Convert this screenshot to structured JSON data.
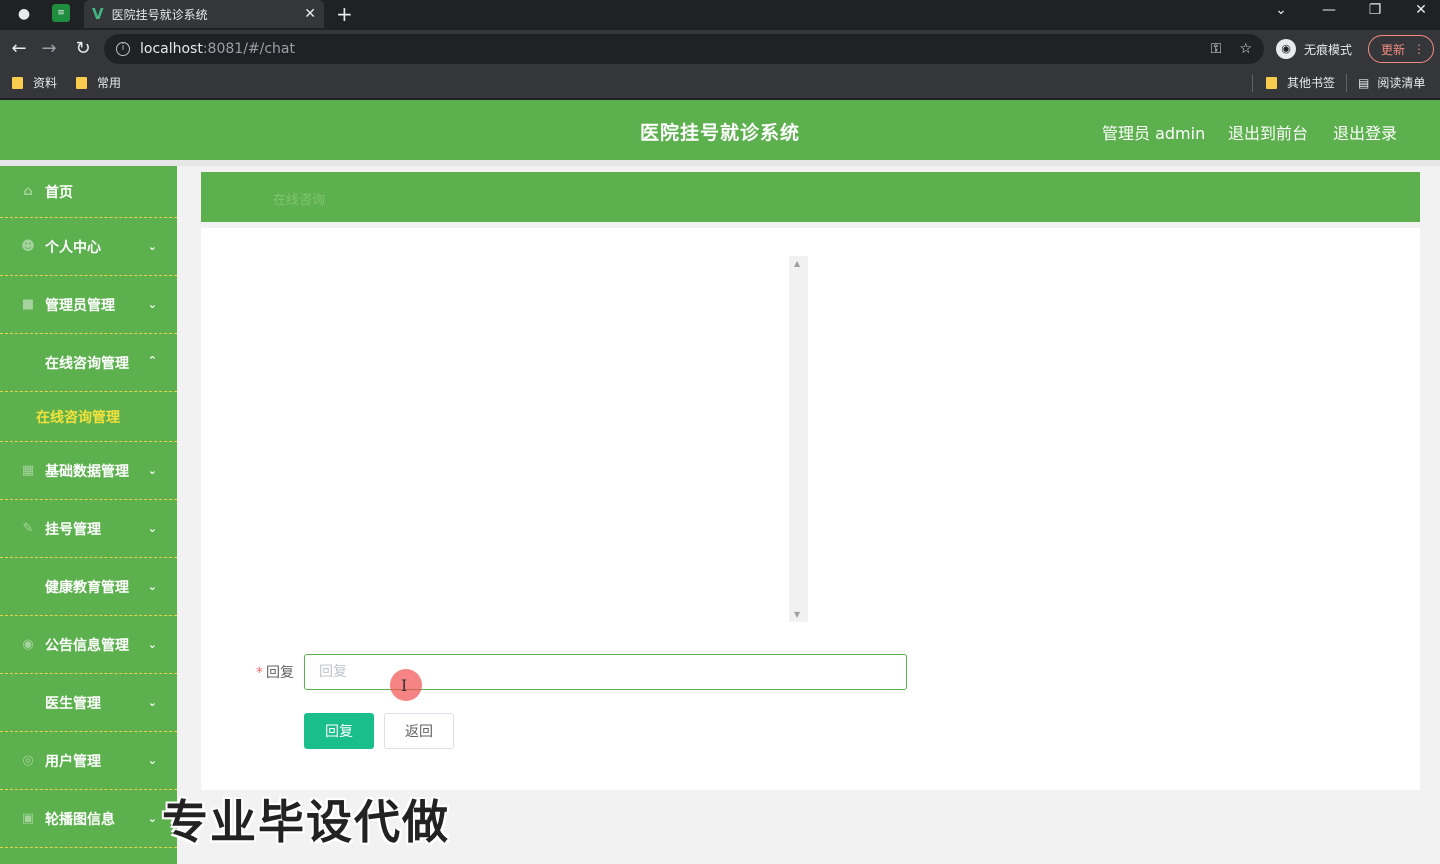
{
  "browser": {
    "tab_title": "医院挂号就诊系统",
    "url_host": "localhost",
    "url_path": ":8081/#/chat",
    "incognito_label": "无痕模式",
    "update_label": "更新",
    "bookmarks": [
      "资料",
      "常用"
    ],
    "bookmarks_right": [
      "其他书签",
      "阅读清单"
    ]
  },
  "header": {
    "title": "医院挂号就诊系统",
    "admin_label": "管理员 admin",
    "exit_front": "退出到前台",
    "logout": "退出登录"
  },
  "sidebar": {
    "items": [
      {
        "label": "首页"
      },
      {
        "label": "个人中心"
      },
      {
        "label": "管理员管理"
      },
      {
        "label": "在线咨询管理"
      },
      {
        "label": "基础数据管理"
      },
      {
        "label": "挂号管理"
      },
      {
        "label": "健康教育管理"
      },
      {
        "label": "公告信息管理"
      },
      {
        "label": "医生管理"
      },
      {
        "label": "用户管理"
      },
      {
        "label": "轮播图信息"
      }
    ],
    "sub_item": "在线咨询管理"
  },
  "main": {
    "breadcrumb": "在线咨询",
    "form": {
      "reply_label": "回复",
      "reply_placeholder": "回复",
      "reply_value": ""
    },
    "buttons": {
      "reply": "回复",
      "back": "返回"
    }
  },
  "watermark": "专业毕设代做",
  "colors": {
    "theme_green": "#5cb04d",
    "submenu_yellow": "#f5e13c",
    "primary_button": "#19be8b"
  }
}
